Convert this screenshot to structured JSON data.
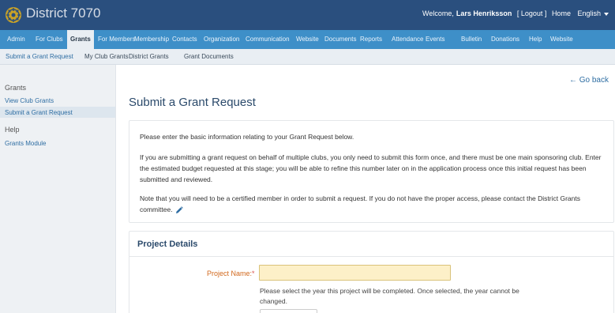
{
  "header": {
    "site_title": "District 7070",
    "welcome_prefix": "Welcome,",
    "user_name": "Lars Henriksson",
    "logout": "[ Logout ]",
    "home": "Home",
    "language": "English"
  },
  "main_nav": [
    {
      "label": "Admin",
      "active": false
    },
    {
      "label": "For Clubs",
      "active": false
    },
    {
      "label": "Grants",
      "active": true
    },
    {
      "label": "For Members",
      "active": false
    },
    {
      "label": "Membership",
      "active": false
    },
    {
      "label": "Contacts",
      "active": false
    },
    {
      "label": "Organization",
      "active": false
    },
    {
      "label": "Communication",
      "active": false
    },
    {
      "label": "Website",
      "active": false
    },
    {
      "label": "Documents",
      "active": false
    },
    {
      "label": "Reports",
      "active": false
    },
    {
      "label": "Attendance",
      "active": false
    },
    {
      "label": "Events",
      "active": false
    },
    {
      "label": "Bulletin",
      "active": false
    },
    {
      "label": "Donations",
      "active": false
    },
    {
      "label": "Help",
      "active": false
    },
    {
      "label": "Website",
      "active": false
    }
  ],
  "sub_nav": [
    {
      "label": "Submit a Grant Request",
      "active": true
    },
    {
      "label": "My Club Grants",
      "active": false
    },
    {
      "label": "District Grants",
      "active": false
    },
    {
      "label": "Grant Documents",
      "active": false
    }
  ],
  "sidebar": {
    "grants_heading": "Grants",
    "view_club_grants": "View Club Grants",
    "submit_grant_request": "Submit a Grant Request",
    "help_heading": "Help",
    "grants_module": "Grants Module"
  },
  "content": {
    "go_back": "← Go back",
    "page_title": "Submit a Grant Request",
    "info_p1": "Please enter the basic information relating to your Grant Request below.",
    "info_p2": "If you are submitting a grant request on behalf of multiple clubs, you only need to submit this form once, and there must be one main sponsoring club. Enter the estimated budget requested at this stage; you will be able to refine this number later on in the application process once this initial request has been submitted and reviewed.",
    "info_p3": "Note that you will need to be a certified member in order to submit a request. If you do not have the proper access, please contact the District Grants committee.",
    "section_title": "Project Details",
    "project_name_label": "Project Name:",
    "required_mark": "*",
    "project_name_value": "",
    "year_help": "Please select the year this project will be completed. Once selected, the year cannot be changed.",
    "year_value": ""
  },
  "colors": {
    "topbar": "#2a4f7e",
    "mainnav": "#3e8fc8",
    "link": "#2f6ea3",
    "input_bg": "#fdf0c8",
    "label_orange": "#d2691e"
  }
}
